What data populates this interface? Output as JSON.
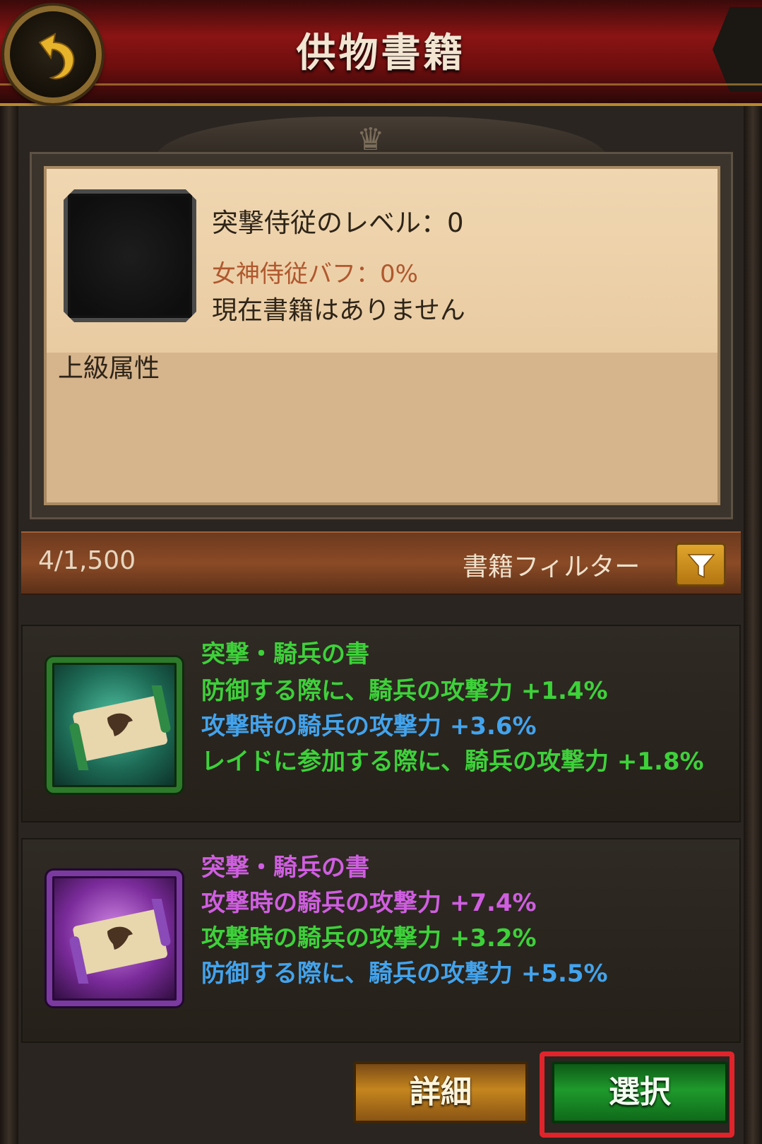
{
  "header": {
    "title": "供物書籍"
  },
  "info": {
    "level_text": "突撃侍従のレベル：0",
    "buff_text": "女神侍従バフ：0%",
    "no_book_text": "現在書籍はありません",
    "advanced_label": "上級属性"
  },
  "bar": {
    "count": "4/1,500",
    "filter_label": "書籍フィルター"
  },
  "books": [
    {
      "name": "突撃・騎兵の書",
      "rarity_color": "#3ed13a",
      "stats": [
        {
          "text": "防御する際に、騎兵の攻撃力 +1.4%",
          "color": "green"
        },
        {
          "text": "攻撃時の騎兵の攻撃力 +3.6%",
          "color": "blue"
        },
        {
          "text": "レイドに参加する際に、騎兵の攻撃力  +1.8%",
          "color": "green"
        }
      ]
    },
    {
      "name": "突撃・騎兵の書",
      "rarity_color": "#cf5ee0",
      "stats": [
        {
          "text": "攻撃時の騎兵の攻撃力 +7.4%",
          "color": "purple"
        },
        {
          "text": "攻撃時の騎兵の攻撃力 +3.2%",
          "color": "green"
        },
        {
          "text": "防御する際に、騎兵の攻撃力 +5.5%",
          "color": "blue"
        }
      ]
    }
  ],
  "buttons": {
    "detail": "詳細",
    "select": "選択"
  },
  "icons": [
    "back-arrow-icon",
    "crown-icon",
    "filter-icon",
    "scroll-icon"
  ]
}
